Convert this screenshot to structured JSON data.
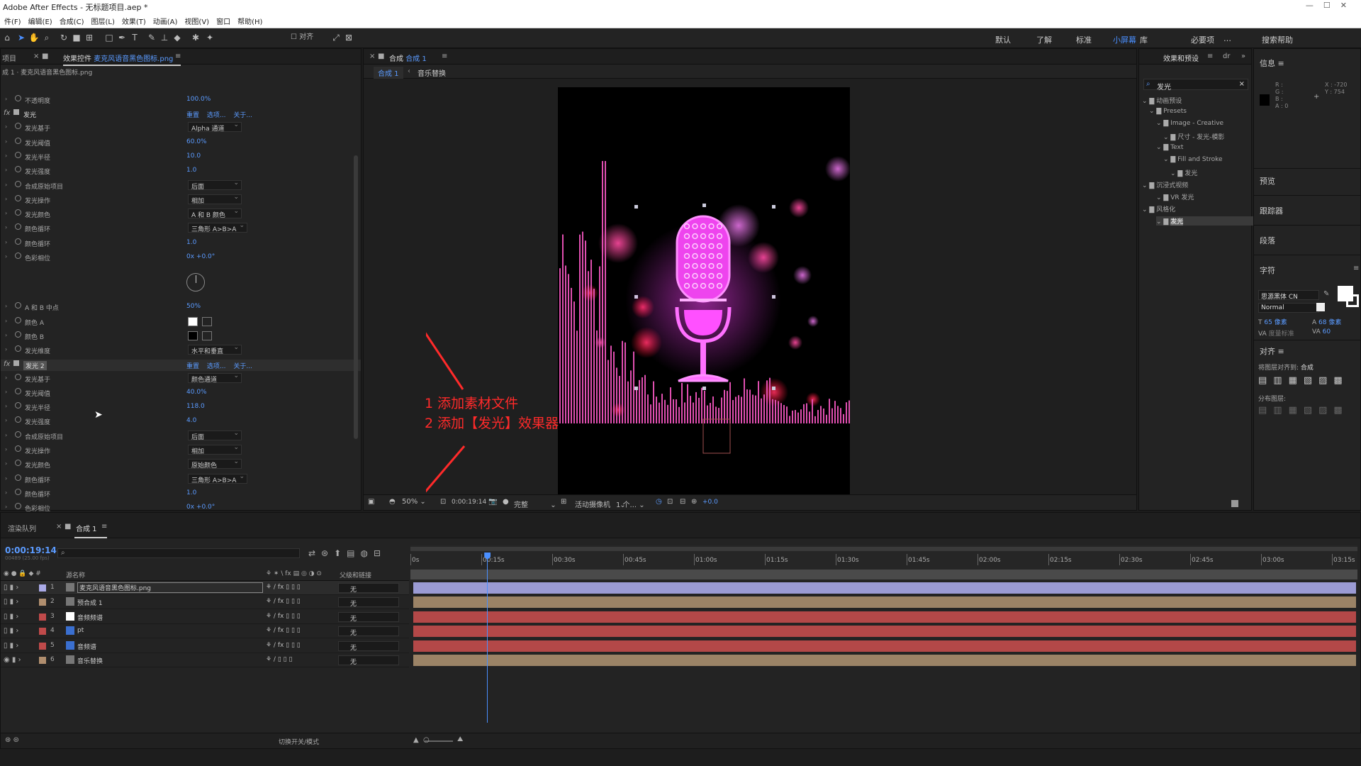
{
  "app": {
    "title": "Adobe After Effects - 无标题项目.aep *",
    "window_controls": [
      "—",
      "☐",
      "✕"
    ]
  },
  "menu": [
    "件(F)",
    "编辑(E)",
    "合成(C)",
    "图层(L)",
    "效果(T)",
    "动画(A)",
    "视图(V)",
    "窗口",
    "帮助(H)"
  ],
  "toolbar": {
    "align_label": "对齐",
    "workspaces": [
      "默认",
      "了解",
      "标准",
      "小屏幕",
      "库",
      "必要项",
      "…",
      "搜索帮助"
    ],
    "active_workspace": "小屏幕"
  },
  "effect_panel": {
    "tab_project": "项目",
    "tab_effects": "效果控件",
    "tab_effects_target": "麦克风语音黑色图标.png",
    "breadcrumb": "成 1 · 麦克风语音黑色图标.png",
    "reset": "重置",
    "options": "选项...",
    "about": "关于...",
    "rows": [
      {
        "kind": "prop",
        "name": "不透明度",
        "value": "100.0%"
      },
      {
        "kind": "fx",
        "name": "发光"
      },
      {
        "kind": "dd",
        "name": "发光基于",
        "value": "Alpha 通道",
        "w": 76
      },
      {
        "kind": "prop",
        "name": "发光阈值",
        "value": "60.0%"
      },
      {
        "kind": "prop",
        "name": "发光半径",
        "value": "10.0"
      },
      {
        "kind": "prop",
        "name": "发光强度",
        "value": "1.0"
      },
      {
        "kind": "dd",
        "name": "合成原始项目",
        "value": "后面",
        "w": 76
      },
      {
        "kind": "dd",
        "name": "发光操作",
        "value": "相加",
        "w": 76
      },
      {
        "kind": "dd",
        "name": "发光颜色",
        "value": "A 和 B 颜色",
        "w": 76
      },
      {
        "kind": "dd",
        "name": "颜色循环",
        "value": "三角形 A>B>A",
        "w": 84
      },
      {
        "kind": "prop",
        "name": "颜色循环",
        "value": "1.0"
      },
      {
        "kind": "prop",
        "name": "色彩相位",
        "value": "0x +0.0°"
      },
      {
        "kind": "dial"
      },
      {
        "kind": "prop",
        "name": "A 和 B 中点",
        "value": "50%"
      },
      {
        "kind": "color",
        "name": "颜色 A",
        "value": "#ffffff"
      },
      {
        "kind": "color",
        "name": "颜色 B",
        "value": "#000000"
      },
      {
        "kind": "dd",
        "name": "发光维度",
        "value": "水平和垂直",
        "w": 76
      },
      {
        "kind": "fx",
        "name": "发光 2",
        "sel": true
      },
      {
        "kind": "dd",
        "name": "发光基于",
        "value": "颜色通道",
        "w": 76
      },
      {
        "kind": "prop",
        "name": "发光阈值",
        "value": "40.0%"
      },
      {
        "kind": "prop",
        "name": "发光半径",
        "value": "118.0"
      },
      {
        "kind": "prop",
        "name": "发光强度",
        "value": "4.0"
      },
      {
        "kind": "dd",
        "name": "合成原始项目",
        "value": "后面",
        "w": 76
      },
      {
        "kind": "dd",
        "name": "发光操作",
        "value": "相加",
        "w": 76
      },
      {
        "kind": "dd",
        "name": "发光颜色",
        "value": "原始颜色",
        "w": 76
      },
      {
        "kind": "dd",
        "name": "颜色循环",
        "value": "三角形 A>B>A",
        "w": 84
      },
      {
        "kind": "prop",
        "name": "颜色循环",
        "value": "1.0"
      },
      {
        "kind": "prop",
        "name": "色彩相位",
        "value": "0x +0.0°"
      }
    ]
  },
  "comp_panel": {
    "tab": "合成",
    "tab_name": "合成 1",
    "crumb_1": "合成 1",
    "crumb_2": "音乐替换",
    "footer": {
      "zoom": "50%",
      "timecode": "0:00:19:14",
      "quality": "完整",
      "camera": "活动摄像机",
      "views": "1 个...",
      "exposure": "+0.0"
    }
  },
  "annotation": {
    "line1": "1 添加素材文件",
    "line2": "2 添加【发光】效果器",
    "color": "#ff2a2a"
  },
  "effects_presets": {
    "tab": "效果和预设",
    "search_value": "发光",
    "tree": [
      {
        "indent": 0,
        "text": "动画预设"
      },
      {
        "indent": 1,
        "text": "Presets"
      },
      {
        "indent": 2,
        "text": "Image - Creative"
      },
      {
        "indent": 3,
        "text": "尺寸 - 发光-模影"
      },
      {
        "indent": 2,
        "text": "Text"
      },
      {
        "indent": 3,
        "text": "Fill and Stroke"
      },
      {
        "indent": 4,
        "text": "发光"
      },
      {
        "indent": 0,
        "text": "沉浸式视频"
      },
      {
        "indent": 2,
        "text": "VR 发光"
      },
      {
        "indent": 0,
        "text": "风格化"
      },
      {
        "indent": 2,
        "text": "发光",
        "hl": true
      }
    ]
  },
  "info": {
    "tab": "信息",
    "r": "R :",
    "g": "G :",
    "b": "B :",
    "a": "A : 0",
    "x": "X : -720",
    "y": "Y : 754"
  },
  "right_sections": [
    "预览",
    "跟踪器",
    "段落"
  ],
  "character": {
    "tab": "字符",
    "font": "思源黑体 CN",
    "style": "Normal",
    "size": "65 像素",
    "leading": "68 像素",
    "kerning": "度量标准",
    "tracking": "60"
  },
  "align": {
    "tab": "对齐",
    "align_to_label": "将图层对齐到:",
    "align_to": "合成",
    "distribute": "分布图层:"
  },
  "timeline": {
    "tab_render": "渲染队列",
    "tab_comp": "合成 1",
    "timecode": "0:00:19:14",
    "fps": "00489 (25.00 fps)",
    "col_source": "源名称",
    "col_parent": "父级和链接",
    "toggle_label": "切换开关/模式",
    "ticks": [
      "0s",
      "00:15s",
      "00:30s",
      "00:45s",
      "01:00s",
      "01:15s",
      "01:30s",
      "01:45s",
      "02:00s",
      "02:15s",
      "02:30s",
      "02:45s",
      "03:00s",
      "03:15s"
    ],
    "current_time_fraction": 0.081,
    "layers": [
      {
        "num": "1",
        "name": "麦克风语音黑色图标.png",
        "label": "#a9a9e6",
        "bar": "#9b9bd4",
        "sel": true,
        "fx": true
      },
      {
        "num": "2",
        "name": "预合成 1",
        "label": "#b08e6e",
        "bar": "#9b8366",
        "fx": true
      },
      {
        "num": "3",
        "name": "音频频谱",
        "label": "#c04a4a",
        "bar": "#b34848",
        "fx": true
      },
      {
        "num": "4",
        "name": "pt",
        "label": "#c04a4a",
        "bar": "#b34848",
        "fx": true
      },
      {
        "num": "5",
        "name": "音频谱",
        "label": "#c04a4a",
        "bar": "#b34848",
        "fx": true
      },
      {
        "num": "6",
        "name": "音乐替换",
        "label": "#b08e6e",
        "bar": "#9b8366",
        "fx": false
      }
    ],
    "parent_value": "无"
  }
}
